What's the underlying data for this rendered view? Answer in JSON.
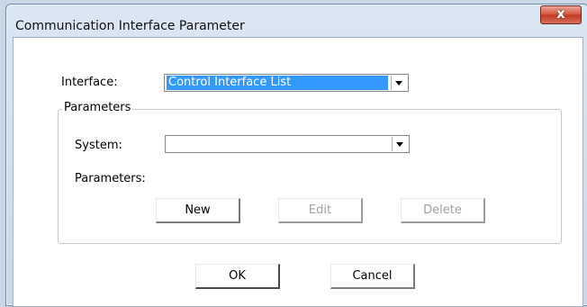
{
  "window": {
    "title": "Communication Interface Parameter",
    "close_label": "x"
  },
  "form": {
    "interface_label": "Interface:",
    "interface_value": "Control Interface List",
    "group_title": "Parameters",
    "system_label": "System:",
    "system_value": "",
    "parameters_label": "Parameters:"
  },
  "buttons": {
    "new": "New",
    "edit": "Edit",
    "delete": "Delete",
    "ok": "OK",
    "cancel": "Cancel"
  },
  "icons": {
    "dropdown": "chevron-down-icon",
    "close": "close-icon"
  }
}
